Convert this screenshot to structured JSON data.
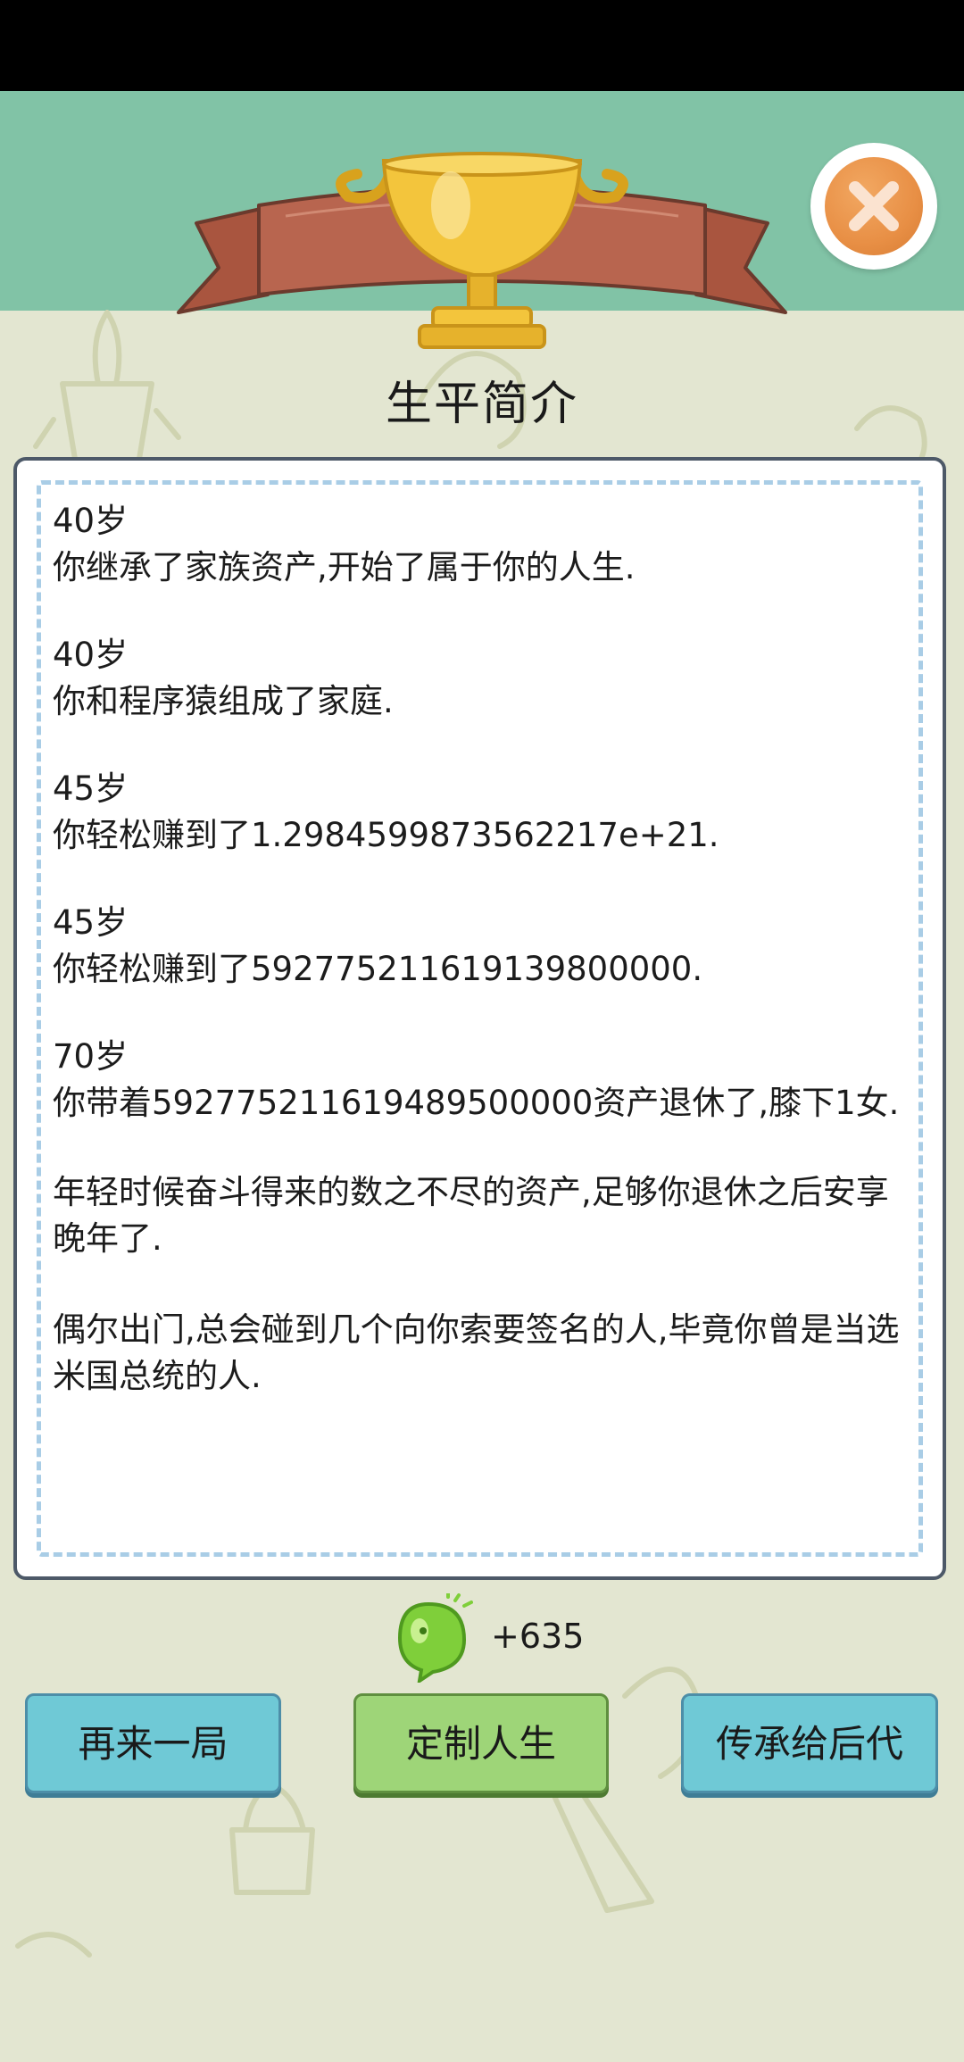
{
  "header": {
    "title": "生平简介"
  },
  "life_events": [
    {
      "age": "40岁",
      "text": "你继承了家族资产,开始了属于你的人生."
    },
    {
      "age": "40岁",
      "text": "你和程序猿组成了家庭."
    },
    {
      "age": "45岁",
      "text": "你轻松赚到了1.2984599873562217e+21."
    },
    {
      "age": "45岁",
      "text": "你轻松赚到了592775211619139800000."
    },
    {
      "age": "70岁",
      "text": "你带着592775211619489500000资产退休了,膝下1女."
    }
  ],
  "summary": [
    "年轻时候奋斗得来的数之不尽的资产,足够你退休之后安享晚年了.",
    "偶尔出门,总会碰到几个向你索要签名的人,毕竟你曾是当选米国总统的人."
  ],
  "reward": {
    "amount": "+635",
    "icon": "green-gem-icon"
  },
  "buttons": {
    "replay": "再来一局",
    "customize": "定制人生",
    "inherit": "传承给后代"
  },
  "colors": {
    "top_band": "#81c3a6",
    "background": "#e3e6d1",
    "ribbon": "#b5634e",
    "trophy": "#f3c53c",
    "close_button": "#e88f45",
    "button_blue": "#6fc9d6",
    "button_green": "#9ed578",
    "dashed_border": "#a9cde6"
  }
}
